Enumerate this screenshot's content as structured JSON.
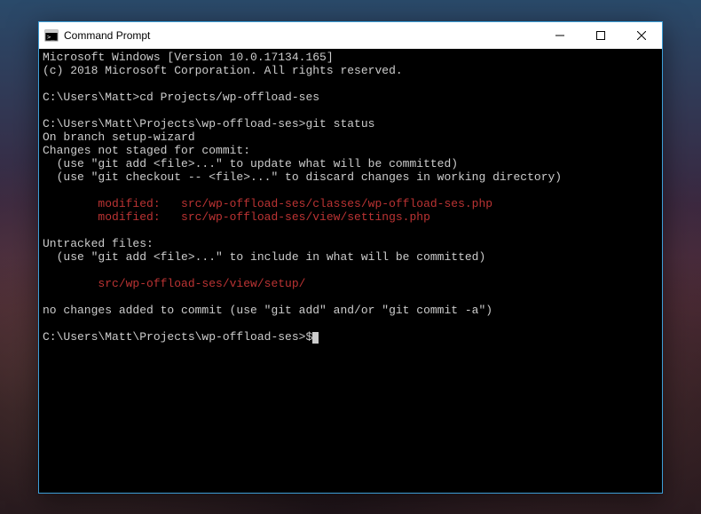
{
  "window": {
    "title": "Command Prompt"
  },
  "terminal": {
    "lines": [
      {
        "text": "Microsoft Windows [Version 10.0.17134.165]",
        "cls": ""
      },
      {
        "text": "(c) 2018 Microsoft Corporation. All rights reserved.",
        "cls": ""
      },
      {
        "text": "",
        "cls": ""
      },
      {
        "text": "C:\\Users\\Matt>cd Projects/wp-offload-ses",
        "cls": ""
      },
      {
        "text": "",
        "cls": ""
      },
      {
        "text": "C:\\Users\\Matt\\Projects\\wp-offload-ses>git status",
        "cls": ""
      },
      {
        "text": "On branch setup-wizard",
        "cls": ""
      },
      {
        "text": "Changes not staged for commit:",
        "cls": ""
      },
      {
        "text": "  (use \"git add <file>...\" to update what will be committed)",
        "cls": ""
      },
      {
        "text": "  (use \"git checkout -- <file>...\" to discard changes in working directory)",
        "cls": ""
      },
      {
        "text": "",
        "cls": ""
      },
      {
        "text": "        modified:   src/wp-offload-ses/classes/wp-offload-ses.php",
        "cls": "red"
      },
      {
        "text": "        modified:   src/wp-offload-ses/view/settings.php",
        "cls": "red"
      },
      {
        "text": "",
        "cls": ""
      },
      {
        "text": "Untracked files:",
        "cls": ""
      },
      {
        "text": "  (use \"git add <file>...\" to include in what will be committed)",
        "cls": ""
      },
      {
        "text": "",
        "cls": ""
      },
      {
        "text": "        src/wp-offload-ses/view/setup/",
        "cls": "red"
      },
      {
        "text": "",
        "cls": ""
      },
      {
        "text": "no changes added to commit (use \"git add\" and/or \"git commit -a\")",
        "cls": ""
      },
      {
        "text": "",
        "cls": ""
      }
    ],
    "prompt": "C:\\Users\\Matt\\Projects\\wp-offload-ses>$"
  }
}
